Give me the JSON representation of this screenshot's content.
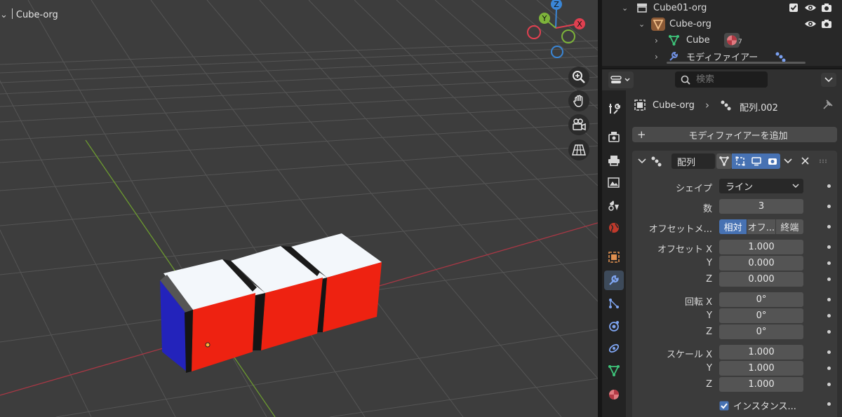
{
  "viewport": {
    "title": "Cube-org",
    "gizmo": {
      "z": "Z",
      "y": "Y",
      "x": "X"
    },
    "nav_icons": [
      "zoom-icon",
      "hand-pan-icon",
      "camera-icon",
      "grid-perspective-icon"
    ]
  },
  "outliner": {
    "rows": [
      {
        "label": "Cube01-org",
        "icon": "collection-icon"
      },
      {
        "label": "Cube-org",
        "icon": "object-icon"
      },
      {
        "label": "Cube",
        "icon": "mesh-icon"
      },
      {
        "label": "モディファイアー",
        "icon": "wrench-icon"
      }
    ],
    "cube_material_badge": "7"
  },
  "properties": {
    "search_placeholder": "検索",
    "breadcrumb": {
      "object": "Cube-org",
      "modifier": "配列.002"
    },
    "add_modifier_label": "モディファイアーを追加",
    "modifier": {
      "name": "配列",
      "fit_type_label": "シェイプ",
      "fit_type_value": "ライン",
      "count_label": "数",
      "count_value": "3",
      "offset_method_label": "オフセットメ...",
      "offset_methods": [
        "相対",
        "オフ...",
        "終端"
      ],
      "offset_x_label": "オフセット X",
      "offset_y_label": "Y",
      "offset_z_label": "Z",
      "offset_values": [
        "1.000",
        "0.000",
        "0.000"
      ],
      "rotation_x_label": "回転 X",
      "rotation_y_label": "Y",
      "rotation_z_label": "Z",
      "rotation_values": [
        "0°",
        "0°",
        "0°"
      ],
      "scale_x_label": "スケール X",
      "scale_y_label": "Y",
      "scale_z_label": "Z",
      "scale_values": [
        "1.000",
        "1.000",
        "1.000"
      ],
      "instance_checkbox_label": "インスタンス..."
    }
  },
  "colors": {
    "accent": "#4772b3",
    "cube_red": "#ee2211",
    "cube_white": "#f4f8fc",
    "cube_blue": "#2222bb",
    "axis_x": "#e04050",
    "axis_y": "#7db33a",
    "axis_z": "#3a86d6"
  }
}
